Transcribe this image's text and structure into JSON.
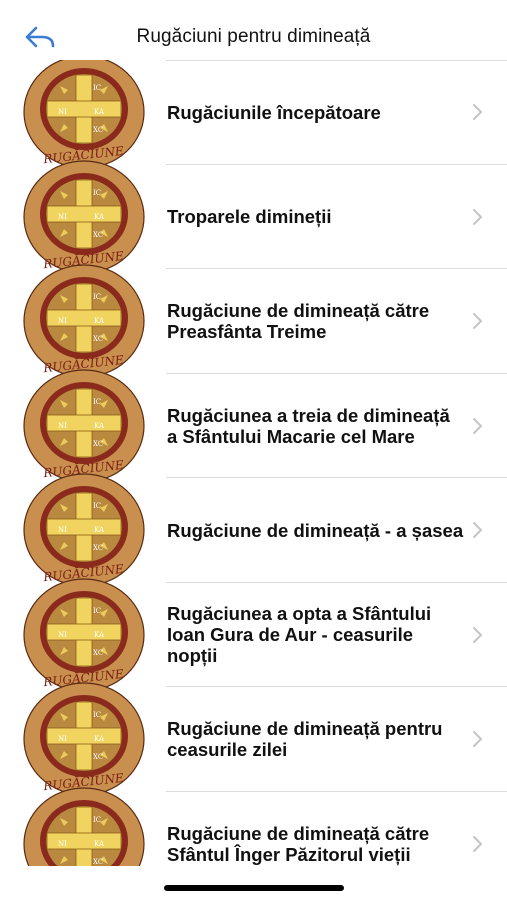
{
  "nav": {
    "title": "Rugăciuni pentru dimineață",
    "back_icon": "back-arrow-icon"
  },
  "medal": {
    "ring_text": "RUGĂCIUNE",
    "corners": [
      "IC",
      "XC",
      "NI",
      "KA"
    ],
    "colors": {
      "ring": "#c98f4e",
      "inner": "#8a2a1c",
      "cross": "#f1d45f",
      "text": "#7a1d12"
    }
  },
  "items": [
    {
      "label": "Rugăciunile începătoare"
    },
    {
      "label": "Troparele dimineții"
    },
    {
      "label": "Rugăciune de dimineață către Preasfânta Treime"
    },
    {
      "label": "Rugăciunea a treia de dimineață a Sfântului Macarie cel Mare"
    },
    {
      "label": "Rugăciune de dimineață - a șasea"
    },
    {
      "label": "Rugăciunea a opta a Sfântului Ioan Gura de Aur - ceasurile nopții"
    },
    {
      "label": "Rugăciune de dimineață pentru ceasurile zilei"
    },
    {
      "label": "Rugăciune de dimineață către Sfântul Înger Păzitorul vieții"
    }
  ]
}
